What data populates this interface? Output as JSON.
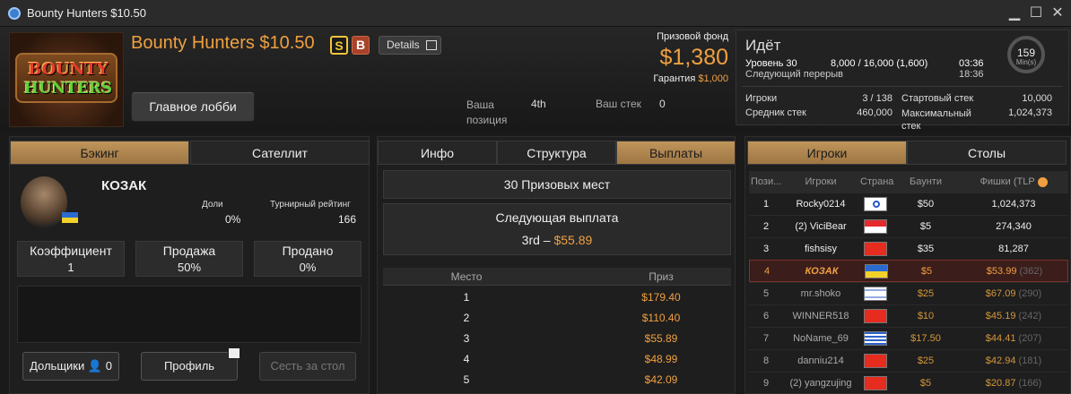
{
  "window": {
    "title": "Bounty Hunters $10.50",
    "minimize": "▁",
    "maximize": "☐",
    "close": "✕"
  },
  "logo": {
    "line1": "BOUNTY",
    "line2": "HUNTERS"
  },
  "header": {
    "tournament_name": "Bounty Hunters $10.50",
    "badge_s": "S",
    "badge_b": "B",
    "details_label": "Details",
    "lobby_button": "Главное лобби",
    "position_label": "Ваша позиция",
    "position_value": "4th",
    "stack_label": "Ваш стек",
    "stack_value": "0",
    "prize_pool_label": "Призовой фонд",
    "prize_pool_value": "$1,380",
    "guarantee_label": "Гарантия",
    "guarantee_value": "$1,000"
  },
  "status": {
    "state": "Идёт",
    "level_label": "Уровень 30",
    "blinds": "8,000 / 16,000 (1,600)",
    "level_time": "03:36",
    "next_break_label": "Следующий перерыв",
    "next_break_time": "18:36",
    "clock_value": "159",
    "clock_unit": "Min(s)",
    "players_label": "Игроки",
    "players_value": "3 / 138",
    "avg_stack_label": "Средник стек",
    "avg_stack_value": "460,000",
    "start_stack_label": "Стартовый стек",
    "start_stack_value": "10,000",
    "max_stack_label": "Максимальный стек",
    "max_stack_value": "1,024,373"
  },
  "left_panel": {
    "tabs": [
      {
        "label": "Бэкинг"
      },
      {
        "label": "Сателлит"
      }
    ],
    "player_name": "КОЗАК",
    "shares_label": "Доли",
    "shares_value": "0%",
    "rating_label": "Турнирный рейтинг",
    "rating_value": "166",
    "stats": [
      {
        "label": "Коэффициент",
        "value": "1"
      },
      {
        "label": "Продажа",
        "value": "50%"
      },
      {
        "label": "Продано",
        "value": "0%"
      }
    ],
    "shareholders_label": "Дольщики",
    "shareholders_count": "0",
    "profile_label": "Профиль",
    "seat_label": "Сесть за стол"
  },
  "mid_panel": {
    "tabs": [
      {
        "label": "Инфо"
      },
      {
        "label": "Структура"
      },
      {
        "label": "Выплаты"
      }
    ],
    "paid_places": "30 Призовых мест",
    "next_payout_label": "Следующая выплата",
    "next_payout_place": "3rd",
    "next_payout_sep": " – ",
    "next_payout_amount": "$55.89",
    "columns": [
      "Место",
      "Приз"
    ],
    "rows": [
      {
        "place": "1",
        "prize": "$179.40"
      },
      {
        "place": "2",
        "prize": "$110.40"
      },
      {
        "place": "3",
        "prize": "$55.89"
      },
      {
        "place": "4",
        "prize": "$48.99"
      },
      {
        "place": "5",
        "prize": "$42.09"
      }
    ]
  },
  "right_panel": {
    "tabs": [
      {
        "label": "Игроки"
      },
      {
        "label": "Столы"
      }
    ],
    "columns": [
      "Пози...",
      "Игроки",
      "Страна",
      "Баунти",
      "Фишки (TLP"
    ],
    "rows": [
      {
        "pos": "1",
        "name": "Rocky0214",
        "flag": "fl-tw",
        "bounty": "$50",
        "chips": "1,024,373",
        "tlp": ""
      },
      {
        "pos": "2",
        "name": "(2) ViciBear",
        "flag": "fl-sg",
        "bounty": "$5",
        "chips": "274,340",
        "tlp": ""
      },
      {
        "pos": "3",
        "name": "fishsisy",
        "flag": "fl-cn",
        "bounty": "$35",
        "chips": "81,287",
        "tlp": ""
      },
      {
        "pos": "4",
        "name": "КОЗАК",
        "flag": "fl-ua",
        "bounty": "$5",
        "chips": "$53.99",
        "tlp": "(362)"
      },
      {
        "pos": "5",
        "name": "mr.shoko",
        "flag": "fl-il",
        "bounty": "$25",
        "chips": "$67.09",
        "tlp": "(290)"
      },
      {
        "pos": "6",
        "name": "WINNER518",
        "flag": "fl-cn",
        "bounty": "$10",
        "chips": "$45.19",
        "tlp": "(242)"
      },
      {
        "pos": "7",
        "name": "NoName_69",
        "flag": "fl-gr",
        "bounty": "$17.50",
        "chips": "$44.41",
        "tlp": "(207)"
      },
      {
        "pos": "8",
        "name": "danniu214",
        "flag": "fl-cn",
        "bounty": "$25",
        "chips": "$42.94",
        "tlp": "(181)"
      },
      {
        "pos": "9",
        "name": "(2) yangzujing",
        "flag": "fl-cn",
        "bounty": "$5",
        "chips": "$20.87",
        "tlp": "(166)"
      }
    ]
  }
}
